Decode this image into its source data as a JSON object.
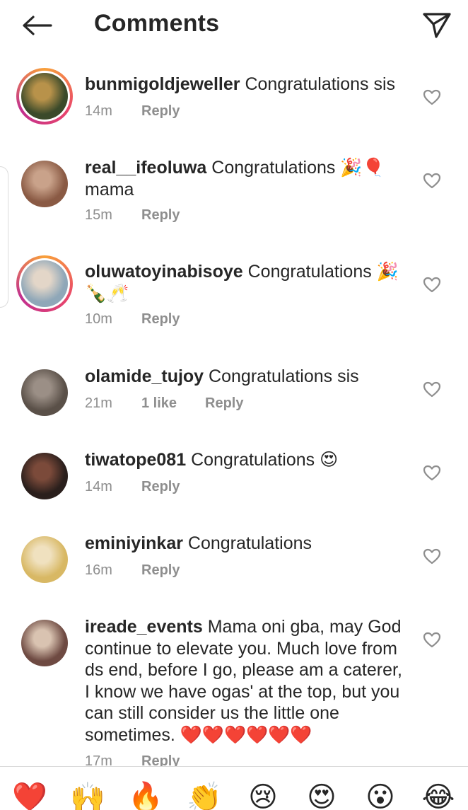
{
  "header": {
    "title": "Comments"
  },
  "comments": [
    {
      "username": "bunmigoldjeweller",
      "text": "Congratulations sis",
      "time": "14m",
      "likes": "",
      "reply": "Reply",
      "avatar_colors": [
        "#3b4a2a",
        "#b8924a"
      ],
      "story": true
    },
    {
      "username": "real__ifeoluwa",
      "text": "Congratulations 🎉🎈",
      "text2": "mama",
      "time": "15m",
      "likes": "",
      "reply": "Reply",
      "avatar_colors": [
        "#8a5a44",
        "#c9a28a"
      ],
      "story": false
    },
    {
      "username": "oluwatoyinabisoye",
      "text": "Congratulations 🎉",
      "text2": "🍾🥂",
      "time": "10m",
      "likes": "",
      "reply": "Reply",
      "avatar_colors": [
        "#8fa7b8",
        "#e3d6c8"
      ],
      "story": true
    },
    {
      "username": "olamide_tujoy",
      "text": "Congratulations sis",
      "time": "21m",
      "likes": "1 like",
      "reply": "Reply",
      "avatar_colors": [
        "#5a5048",
        "#9b8f86"
      ],
      "story": false
    },
    {
      "username": "tiwatope081",
      "text": "Congratulations 😍",
      "time": "14m",
      "likes": "",
      "reply": "Reply",
      "avatar_colors": [
        "#2a1f1c",
        "#7b4a3a"
      ],
      "story": false
    },
    {
      "username": "eminiyinkar",
      "text": "Congratulations",
      "time": "16m",
      "likes": "",
      "reply": "Reply",
      "avatar_colors": [
        "#d8b864",
        "#f0e1bf"
      ],
      "story": false
    },
    {
      "username": "ireade_events",
      "text": "Mama oni gba, may God continue to elevate you. Much love from ds end, before I go, please am a caterer, I know we have ogas' at the top, but you can still consider us the little one sometimes. ❤️❤️❤️❤️❤️❤️",
      "time": "17m",
      "likes": "",
      "reply": "Reply",
      "avatar_colors": [
        "#6e4a42",
        "#d9c3b1"
      ],
      "story": false
    }
  ],
  "emoji_bar": [
    "❤️",
    "🙌",
    "🔥",
    "👏",
    "😢",
    "😍",
    "😮",
    "😂"
  ],
  "colors": {
    "text": "#262626",
    "meta": "#8e8e8e",
    "divider": "#dbdbdb"
  }
}
